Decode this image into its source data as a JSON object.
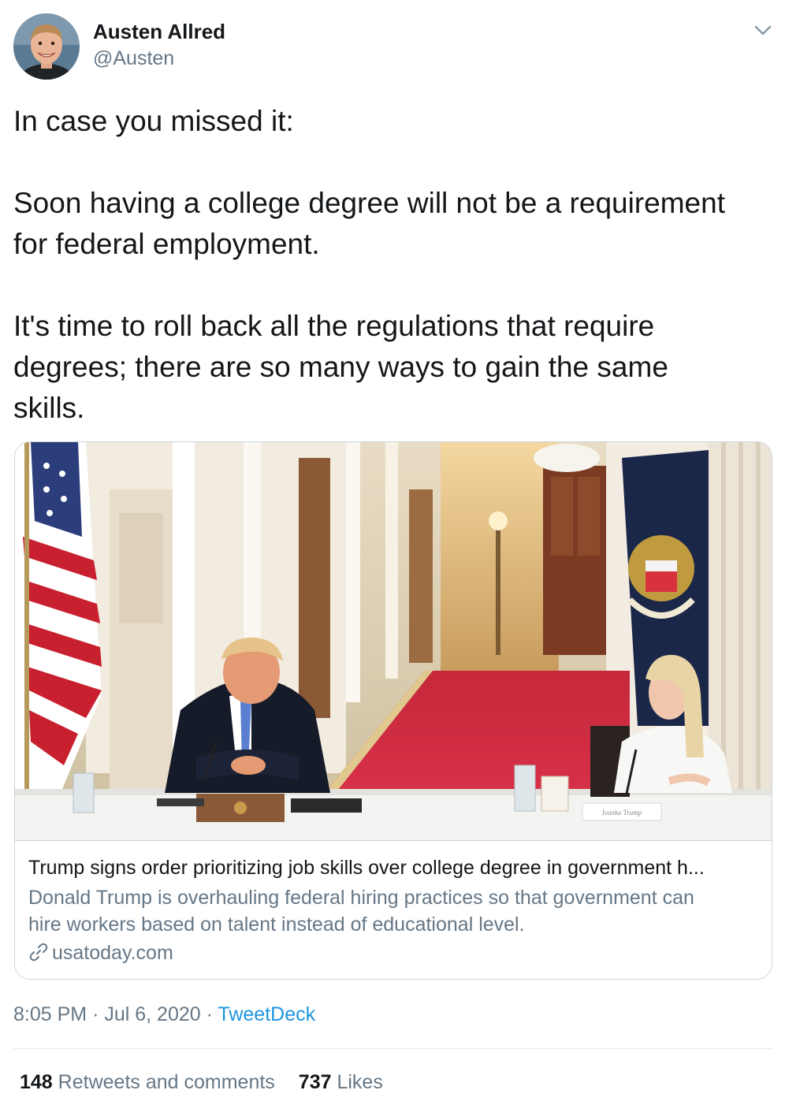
{
  "author": {
    "name": "Austen Allred",
    "handle": "@Austen"
  },
  "tweet": {
    "paragraphs": [
      [
        "In case you missed it:"
      ],
      [
        "Soon having a college degree will not be a requirement",
        "for federal employment."
      ],
      [
        "It's time to roll back all the regulations that require",
        "degrees; there are so many ways to gain the same",
        "skills."
      ]
    ]
  },
  "card": {
    "title": "Trump signs order prioritizing job skills over college degree in government h...",
    "description_lines": [
      "Donald Trump is overhauling federal hiring practices so that government can",
      "hire workers based on talent instead of educational level."
    ],
    "domain": "usatoday.com",
    "image_caption_text": "Ivanka Trump"
  },
  "meta": {
    "time": "8:05 PM",
    "separator": "·",
    "date": "Jul 6, 2020",
    "source": "TweetDeck"
  },
  "stats": {
    "retweets_count": "148",
    "retweets_label": "Retweets and comments",
    "likes_count": "737",
    "likes_label": "Likes"
  },
  "colors": {
    "text": "#14171a",
    "secondary": "#657786",
    "link": "#1b95e0",
    "border": "#ccd6dd"
  },
  "icons": {
    "caret": "chevron-down-icon",
    "link": "link-icon"
  }
}
